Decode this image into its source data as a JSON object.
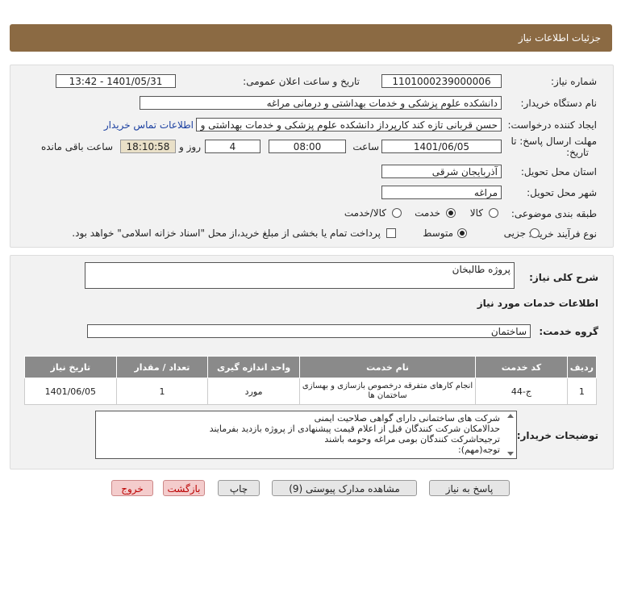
{
  "header": {
    "title": "جزئیات اطلاعات نیاز"
  },
  "form": {
    "need_number": {
      "label": "شماره نیاز:",
      "value": "1101000239000006"
    },
    "announce_date": {
      "label": "تاریخ و ساعت اعلان عمومی:",
      "value": "1401/05/31 - 13:42"
    },
    "buyer_org": {
      "label": "نام دستگاه خریدار:",
      "value": "دانشکده علوم پزشکی و خدمات بهداشتی و درمانی مراغه"
    },
    "requester": {
      "label": "ایجاد کننده درخواست:",
      "value": "حسن قربانی تازه کند کارپرداز دانشکده علوم پزشکی و خدمات بهداشتی و درمانی مراغه",
      "contact_link": "اطلاعات تماس خریدار"
    },
    "deadline": {
      "label1": "مهلت ارسال پاسخ: تا",
      "label2": "تاریخ:",
      "date": "1401/06/05",
      "time_label": "ساعت",
      "time": "08:00",
      "days": "4",
      "days_label": "روز و",
      "remaining": "18:10:58",
      "remaining_label": "ساعت باقی مانده"
    },
    "province": {
      "label": "استان محل تحویل:",
      "value": "آذربایجان شرقی"
    },
    "city": {
      "label": "شهر محل تحویل:",
      "value": "مراغه"
    },
    "category": {
      "label": "طبقه بندی موضوعی:",
      "options": [
        "کالا",
        "خدمت",
        "کالا/خدمت"
      ],
      "selected": "خدمت"
    },
    "purchase_type": {
      "label": "نوع فرآیند خرید :",
      "options": [
        "جزیی",
        "متوسط"
      ],
      "selected": "متوسط",
      "note": "پرداخت تمام یا بخشی از مبلغ خرید،از محل \"اسناد خزانه اسلامی\" خواهد بود."
    }
  },
  "summary": {
    "label": "شرح کلی نیاز:",
    "value": "پروژه طالبخان"
  },
  "services_title": "اطلاعات خدمات مورد نیاز",
  "service_group": {
    "label": "گروه خدمت:",
    "value": "ساختمان"
  },
  "table": {
    "headers": [
      "ردیف",
      "کد خدمت",
      "نام خدمت",
      "واحد اندازه گیری",
      "تعداد / مقدار",
      "تاریخ نیاز"
    ],
    "rows": [
      {
        "row": "1",
        "code": "ج-44",
        "name": "انجام کارهای متفرقه درخصوص بازسازی و بهسازی ساختمان ها",
        "unit": "مورد",
        "qty": "1",
        "date": "1401/06/05"
      }
    ]
  },
  "buyer_notes": {
    "label": "توضیحات خریدار:",
    "lines": [
      "شرکت های ساختمانی دارای گواهی صلاحیت ایمنی",
      "حدالامکان شرکت کنندگان قبل از اعلام قیمت پیشنهادی از پروژه بازدید بفرمایند",
      "ترجیحاشرکت کنندگان بومی مراغه وحومه باشند",
      "توجه(مهم):"
    ]
  },
  "buttons": {
    "reply": "پاسخ به نیاز",
    "attachments": "مشاهده مدارک پیوستی (9)",
    "print": "چاپ",
    "back": "بازگشت",
    "exit": "خروج"
  }
}
